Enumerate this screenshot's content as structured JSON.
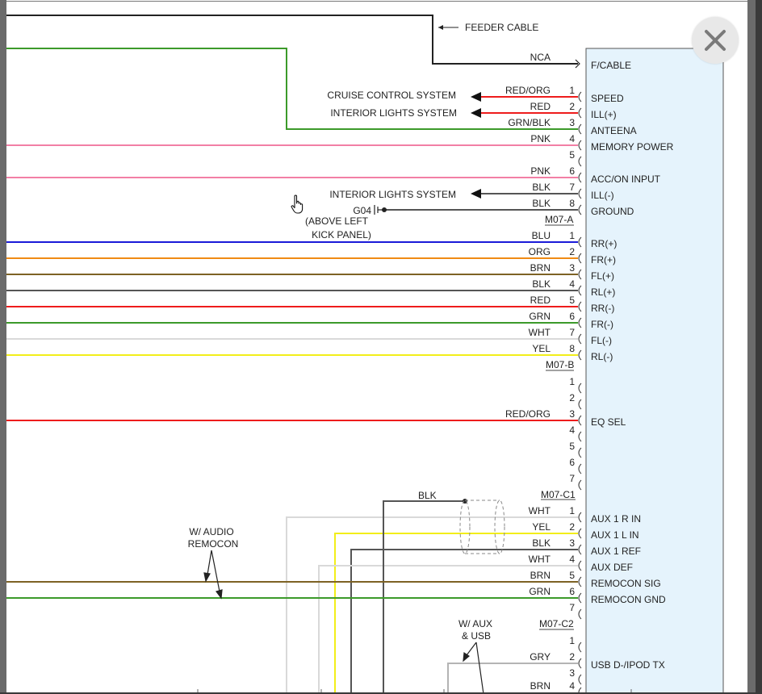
{
  "feeder_cable": "FEEDER CABLE",
  "connector_box": {
    "pins": [
      {
        "wire": "NCA",
        "num": "",
        "func": "F/CABLE"
      },
      {
        "wire": "RED/ORG",
        "num": "1",
        "func": "SPEED"
      },
      {
        "wire": "RED",
        "num": "2",
        "func": "ILL(+)"
      },
      {
        "wire": "GRN/BLK",
        "num": "3",
        "func": "ANTEENA"
      },
      {
        "wire": "PNK",
        "num": "4",
        "func": "MEMORY POWER"
      },
      {
        "wire": "",
        "num": "5",
        "func": ""
      },
      {
        "wire": "PNK",
        "num": "6",
        "func": "ACC/ON INPUT"
      },
      {
        "wire": "BLK",
        "num": "7",
        "func": "ILL(-)"
      },
      {
        "wire": "BLK",
        "num": "8",
        "func": "GROUND"
      },
      {
        "wire": "BLU",
        "num": "1",
        "func": "RR(+)"
      },
      {
        "wire": "ORG",
        "num": "2",
        "func": "FR(+)"
      },
      {
        "wire": "BRN",
        "num": "3",
        "func": "FL(+)"
      },
      {
        "wire": "BLK",
        "num": "4",
        "func": "RL(+)"
      },
      {
        "wire": "RED",
        "num": "5",
        "func": "RR(-)"
      },
      {
        "wire": "GRN",
        "num": "6",
        "func": "FR(-)"
      },
      {
        "wire": "WHT",
        "num": "7",
        "func": "FL(-)"
      },
      {
        "wire": "YEL",
        "num": "8",
        "func": "RL(-)"
      },
      {
        "wire": "",
        "num": "1",
        "func": ""
      },
      {
        "wire": "",
        "num": "2",
        "func": ""
      },
      {
        "wire": "RED/ORG",
        "num": "3",
        "func": "EQ SEL"
      },
      {
        "wire": "",
        "num": "4",
        "func": ""
      },
      {
        "wire": "",
        "num": "5",
        "func": ""
      },
      {
        "wire": "",
        "num": "6",
        "func": ""
      },
      {
        "wire": "",
        "num": "7",
        "func": ""
      },
      {
        "wire": "WHT",
        "num": "1",
        "func": "AUX 1 R IN"
      },
      {
        "wire": "YEL",
        "num": "2",
        "func": "AUX 1 L IN"
      },
      {
        "wire": "BLK",
        "num": "3",
        "func": "AUX 1 REF"
      },
      {
        "wire": "WHT",
        "num": "4",
        "func": "AUX DEF"
      },
      {
        "wire": "BRN",
        "num": "5",
        "func": "REMOCON SIG"
      },
      {
        "wire": "GRN",
        "num": "6",
        "func": "REMOCON GND"
      },
      {
        "wire": "",
        "num": "7",
        "func": ""
      },
      {
        "wire": "",
        "num": "1",
        "func": ""
      },
      {
        "wire": "GRY",
        "num": "2",
        "func": "USB D-/IPOD TX"
      },
      {
        "wire": "",
        "num": "3",
        "func": ""
      },
      {
        "wire": "BRN",
        "num": "4",
        "func": ""
      }
    ],
    "connector_ids": [
      "M07-A",
      "M07-B",
      "M07-C1",
      "M07-C2"
    ]
  },
  "destinations": {
    "cruise_control": "CRUISE CONTROL SYSTEM",
    "interior_lights_1": "INTERIOR LIGHTS SYSTEM",
    "interior_lights_2": "INTERIOR LIGHTS SYSTEM"
  },
  "ground": {
    "id": "G04",
    "location_line1": "(ABOVE LEFT",
    "location_line2": "KICK PANEL)"
  },
  "shield_wire": "BLK",
  "notes": {
    "audio_remocon_line1": "W/ AUDIO",
    "audio_remocon_line2": "REMOCON",
    "aux_usb_line1": "W/ AUX",
    "aux_usb_line2": "& USB"
  },
  "colors": {
    "red": "#ee1c1c",
    "green": "#3c9a2a",
    "pink": "#f27fa5",
    "black": "#555555",
    "blue": "#1a1ad8",
    "orange": "#f08a14",
    "brown": "#7d6224",
    "white_wire": "#d9d9d9",
    "yellow": "#f2ee1a",
    "gray": "#b4b4b4",
    "connector_fill": "#e5f3fc"
  }
}
